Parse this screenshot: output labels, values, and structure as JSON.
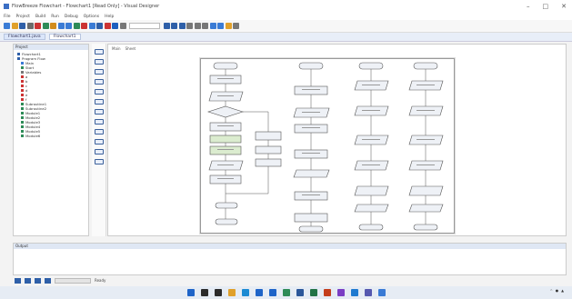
{
  "window": {
    "title": "FlowBreeze Flowchart - Flowchart1 [Read Only] - Visual Designer",
    "controls": [
      "–",
      "□",
      "✕"
    ]
  },
  "menu": [
    "File",
    "Project",
    "Build",
    "Run",
    "Debug",
    "Options",
    "Help"
  ],
  "toolbar": {
    "icons": [
      {
        "name": "new-icon",
        "color": "#3a7bd5"
      },
      {
        "name": "open-icon",
        "color": "#e0a02a"
      },
      {
        "name": "save-icon",
        "color": "#2e5fa8"
      },
      {
        "name": "print-icon",
        "color": "#6b6b6b"
      },
      {
        "name": "cut-icon",
        "color": "#c33"
      },
      {
        "name": "copy-icon",
        "color": "#2e8b57"
      },
      {
        "name": "paste-icon",
        "color": "#d28c1c"
      },
      {
        "name": "undo-icon",
        "color": "#3a7bd5"
      },
      {
        "name": "redo-icon",
        "color": "#3a7bd5"
      },
      {
        "name": "run-icon",
        "color": "#2e8b57"
      },
      {
        "name": "stop-icon",
        "color": "#c33"
      },
      {
        "name": "debug-icon",
        "color": "#3a7bd5"
      },
      {
        "name": "step-icon",
        "color": "#2e5fa8"
      },
      {
        "name": "breakpoint-icon",
        "color": "#c33"
      },
      {
        "name": "help-icon",
        "color": "#1e5fbf"
      },
      {
        "name": "settings-icon",
        "color": "#777"
      }
    ],
    "combo_value": "",
    "icons2": [
      {
        "name": "zoom-in-icon",
        "color": "#2e5fa8"
      },
      {
        "name": "zoom-out-icon",
        "color": "#2e5fa8"
      },
      {
        "name": "fit-icon",
        "color": "#2e5fa8"
      },
      {
        "name": "grid-icon",
        "color": "#777"
      },
      {
        "name": "align-icon",
        "color": "#777"
      },
      {
        "name": "layout-icon",
        "color": "#777"
      },
      {
        "name": "export-icon",
        "color": "#3a7bd5"
      },
      {
        "name": "image-icon",
        "color": "#3a7bd5"
      },
      {
        "name": "chart-icon",
        "color": "#e0a02a"
      },
      {
        "name": "table-icon",
        "color": "#777"
      }
    ]
  },
  "tabs": [
    {
      "label": "Flowchart1.java",
      "active": true
    },
    {
      "label": "Flowchart1",
      "active": false
    }
  ],
  "left_panel": {
    "header": "Project",
    "items": [
      {
        "label": "Flowchart1",
        "color": "#2e5fa8"
      },
      {
        "label": "Program Flow",
        "color": "#2e5fa8"
      },
      {
        "label": "Main",
        "color": "#3a7bd5"
      },
      {
        "label": "Start",
        "color": "#2e8b57"
      },
      {
        "label": "Variables",
        "color": "#777"
      },
      {
        "label": "a",
        "color": "#c33"
      },
      {
        "label": "b",
        "color": "#c33"
      },
      {
        "label": "c",
        "color": "#c33"
      },
      {
        "label": "d",
        "color": "#c33"
      },
      {
        "label": "e",
        "color": "#c33"
      },
      {
        "label": "f",
        "color": "#c33"
      },
      {
        "label": "Subroutine1",
        "color": "#2e8b57"
      },
      {
        "label": "Subroutine2",
        "color": "#2e8b57"
      },
      {
        "label": "Module1",
        "color": "#2e8b57"
      },
      {
        "label": "Module2",
        "color": "#2e8b57"
      },
      {
        "label": "Module3",
        "color": "#2e8b57"
      },
      {
        "label": "Module4",
        "color": "#2e8b57"
      },
      {
        "label": "Module5",
        "color": "#2e8b57"
      },
      {
        "label": "Module6",
        "color": "#2e8b57"
      }
    ]
  },
  "palette": [
    "start-end-shape",
    "process-shape",
    "io-shape",
    "decision-shape",
    "loop-shape",
    "call-shape",
    "comment-shape",
    "connector-shape",
    "output-shape",
    "input-shape",
    "end-shape",
    "delay-shape"
  ],
  "canvas": {
    "tabs": [
      "Main",
      "Sheet"
    ]
  },
  "bottom_panel": {
    "header": "Output"
  },
  "status": {
    "text": "Ready"
  },
  "taskbar": {
    "apps": [
      {
        "name": "start-icon",
        "color": "#1e64c8"
      },
      {
        "name": "search-icon",
        "color": "#2b2b2b"
      },
      {
        "name": "task-view-icon",
        "color": "#2b2b2b"
      },
      {
        "name": "explorer-icon",
        "color": "#e0a02a"
      },
      {
        "name": "edge-icon",
        "color": "#1b8ad3"
      },
      {
        "name": "store-icon",
        "color": "#1e64c8"
      },
      {
        "name": "mail-icon",
        "color": "#1e64c8"
      },
      {
        "name": "chrome-icon",
        "color": "#2e8b57"
      },
      {
        "name": "word-icon",
        "color": "#2b579a"
      },
      {
        "name": "excel-icon",
        "color": "#217346"
      },
      {
        "name": "powerpoint-icon",
        "color": "#c43e1c"
      },
      {
        "name": "app-icon",
        "color": "#7a3ec4"
      },
      {
        "name": "vscode-icon",
        "color": "#1f7ad0"
      },
      {
        "name": "teams-icon",
        "color": "#5558af"
      },
      {
        "name": "settings-icon",
        "color": "#3a7bd5"
      }
    ],
    "clock_time": "",
    "clock_date": ""
  }
}
